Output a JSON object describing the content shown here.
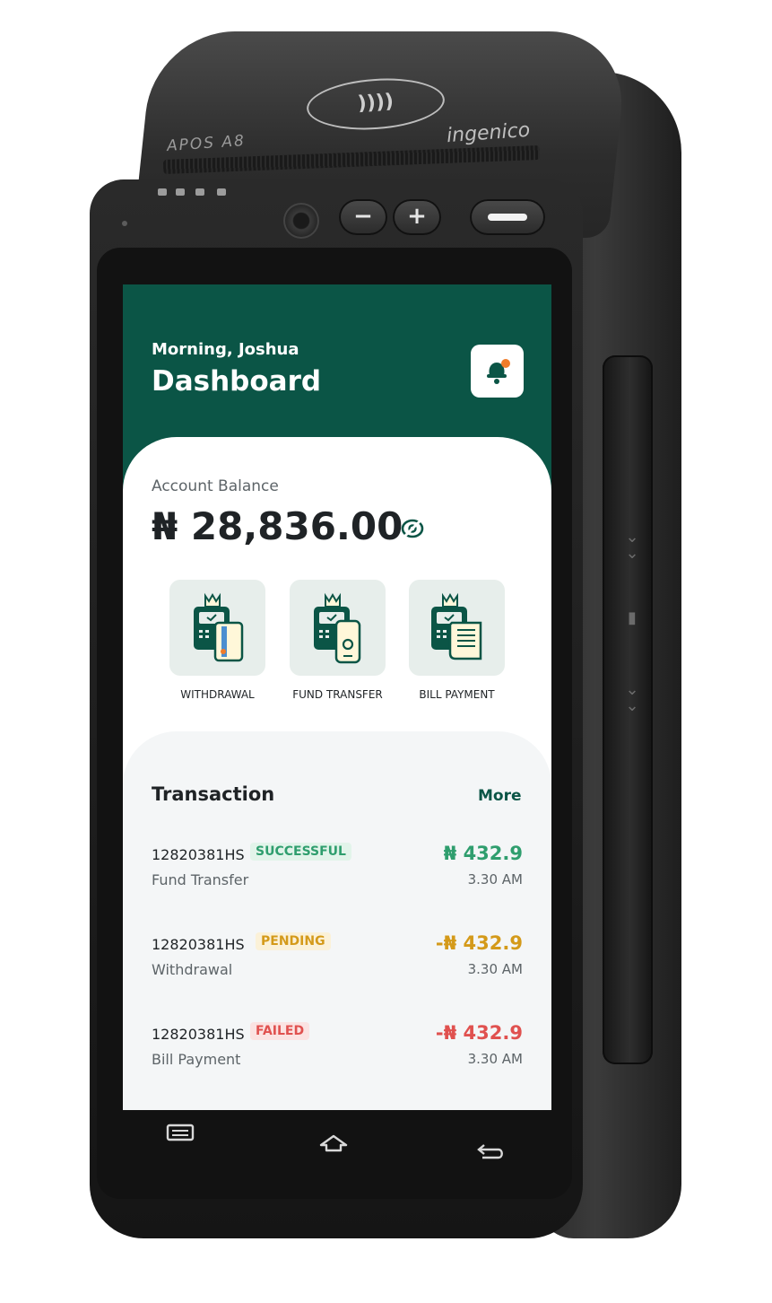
{
  "device": {
    "model": "APOS A8",
    "brand": "ingenico",
    "volume_down": "−",
    "volume_up": "+",
    "nfc_symbol": "))))"
  },
  "header": {
    "greeting": "Morning, Joshua",
    "title": "Dashboard",
    "bell_icon": "bell-icon",
    "notification_color": "#f07c2a"
  },
  "balance": {
    "label": "Account Balance",
    "amount": "₦ 28,836.00",
    "toggle_icon": "eye-icon"
  },
  "actions": [
    {
      "label": "WITHDRAWAL",
      "icon": "pos-card-icon"
    },
    {
      "label": "FUND TRANSFER",
      "icon": "pos-phone-icon"
    },
    {
      "label": "BILL PAYMENT",
      "icon": "pos-receipt-icon"
    }
  ],
  "transactions": {
    "title": "Transaction",
    "more_label": "More",
    "items": [
      {
        "id": "12820381HS",
        "status": "SUCCESSFUL",
        "type": "Fund Transfer",
        "amount": "₦ 432.9",
        "time": "3.30 AM",
        "status_color": "#2f9e6e",
        "status_bg": "#e2f4ea",
        "amount_color": "#2f9e6e"
      },
      {
        "id": "12820381HS",
        "status": "PENDING",
        "type": "Withdrawal",
        "amount": "-₦ 432.9",
        "time": "3.30 AM",
        "status_color": "#d49a1a",
        "status_bg": "#fbf1d8",
        "amount_color": "#d49a1a"
      },
      {
        "id": "12820381HS",
        "status": "FAILED",
        "type": "Bill Payment",
        "amount": "-₦ 432.9",
        "time": "3.30 AM",
        "status_color": "#e0514f",
        "status_bg": "#fbe3e2",
        "amount_color": "#e0514f"
      }
    ]
  },
  "nav": {
    "menu_icon": "menu-icon",
    "home_icon": "home-icon",
    "back_icon": "back-icon"
  },
  "colors": {
    "brand_green": "#0b5546",
    "tile_bg": "#e7eeeb"
  }
}
